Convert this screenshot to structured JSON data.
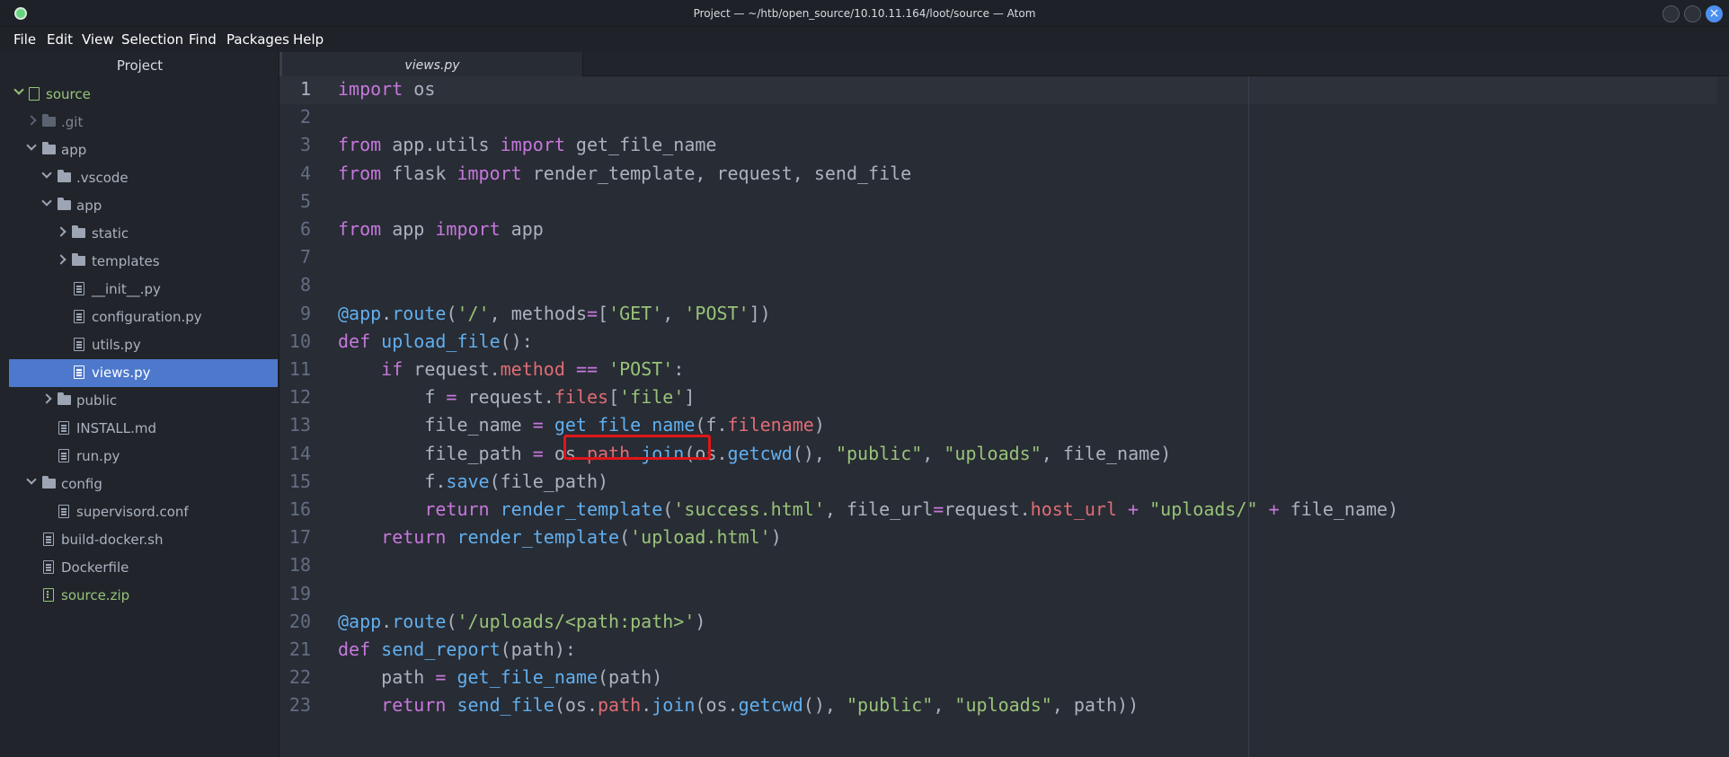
{
  "window": {
    "title": "Project — ~/htb/open_source/10.10.11.164/loot/source — Atom",
    "close_glyph": "×"
  },
  "menu": [
    {
      "label": "File"
    },
    {
      "label": "Edit"
    },
    {
      "label": "View"
    },
    {
      "label": "Selection"
    },
    {
      "label": "Find"
    },
    {
      "label": "Packages"
    },
    {
      "label": "Help"
    }
  ],
  "tree": {
    "header": "Project",
    "items": [
      {
        "label": "source",
        "kind": "repo",
        "expanded": true
      },
      {
        "label": ".git",
        "kind": "folder",
        "expanded": false
      },
      {
        "label": "app",
        "kind": "folder",
        "expanded": true
      },
      {
        "label": ".vscode",
        "kind": "folder",
        "expanded": true
      },
      {
        "label": "app",
        "kind": "folder",
        "expanded": true
      },
      {
        "label": "static",
        "kind": "folder",
        "expanded": false
      },
      {
        "label": "templates",
        "kind": "folder",
        "expanded": false
      },
      {
        "label": "__init__.py",
        "kind": "file"
      },
      {
        "label": "configuration.py",
        "kind": "file"
      },
      {
        "label": "utils.py",
        "kind": "file"
      },
      {
        "label": "views.py",
        "kind": "file",
        "selected": true
      },
      {
        "label": "public",
        "kind": "folder",
        "expanded": false
      },
      {
        "label": "INSTALL.md",
        "kind": "file"
      },
      {
        "label": "run.py",
        "kind": "file"
      },
      {
        "label": "config",
        "kind": "folder",
        "expanded": true
      },
      {
        "label": "supervisord.conf",
        "kind": "file"
      },
      {
        "label": "build-docker.sh",
        "kind": "file"
      },
      {
        "label": "Dockerfile",
        "kind": "file"
      },
      {
        "label": "source.zip",
        "kind": "zip"
      }
    ]
  },
  "editor": {
    "tab_label": "views.py",
    "line_numbers": [
      "1",
      "2",
      "3",
      "4",
      "5",
      "6",
      "7",
      "8",
      "9",
      "10",
      "11",
      "12",
      "13",
      "14",
      "15",
      "16",
      "17",
      "18",
      "19",
      "20",
      "21",
      "22",
      "23"
    ],
    "lines": [
      "import os",
      "",
      "from app.utils import get_file_name",
      "from flask import render_template, request, send_file",
      "",
      "from app import app",
      "",
      "",
      "@app.route('/', methods=['GET', 'POST'])",
      "def upload_file():",
      "    if request.method == 'POST':",
      "        f = request.files['file']",
      "        file_name = get_file_name(f.filename)",
      "        file_path = os.path.join(os.getcwd(), \"public\", \"uploads\", file_name)",
      "        f.save(file_path)",
      "        return render_template('success.html', file_url=request.host_url + \"uploads/\" + file_name)",
      "    return render_template('upload.html')",
      "",
      "",
      "@app.route('/uploads/<path:path>')",
      "def send_report(path):",
      "    path = get_file_name(path)",
      "    return send_file(os.path.join(os.getcwd(), \"public\", \"uploads\", path))"
    ],
    "highlighted_text": "os.path.join",
    "highlight_color": "#e0161a"
  }
}
